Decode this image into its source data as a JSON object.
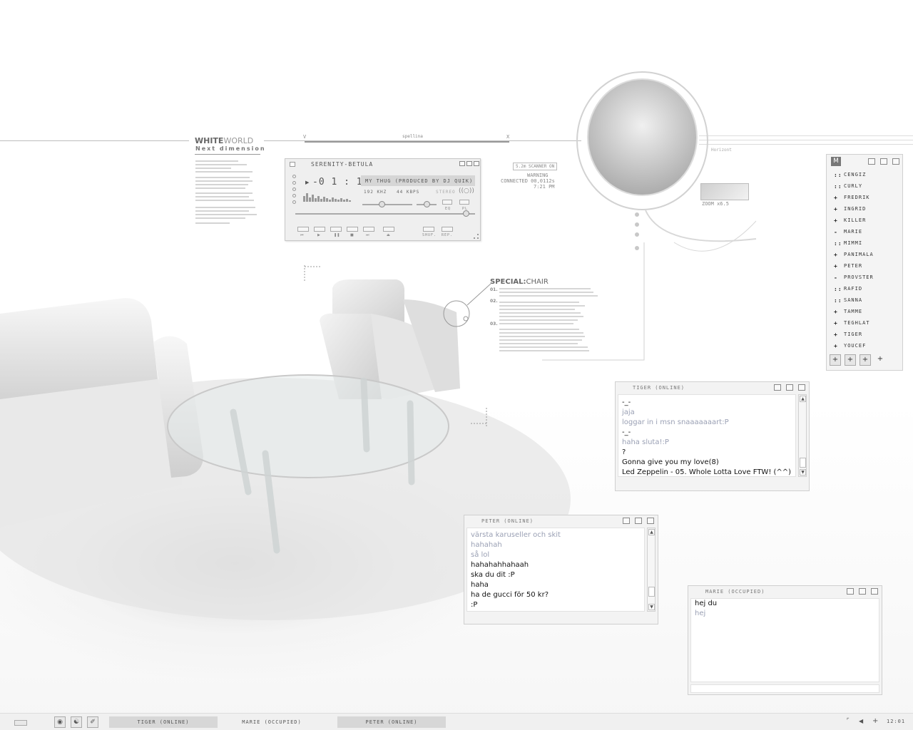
{
  "whiteworld": {
    "title_bold": "WHITE",
    "title_light": "WORLD",
    "subtitle": "Next dimension"
  },
  "hud": {
    "axis_v": "V",
    "axis_x": "X",
    "axis_mid": "spellina",
    "scanner": "5.2m SCANNER ON",
    "warning": "WARNING",
    "connected": "CONNECTED 00,0112s",
    "time": "7:21 PM",
    "zoom": "ZOOM x6.5",
    "horizont": "Horizont"
  },
  "special": {
    "title_bold": "SPECIAL:",
    "title_light": "CHAIR",
    "items": [
      "01.",
      "02.",
      "03."
    ]
  },
  "player": {
    "title": "SERENITY-BETULA",
    "time": "-0 1 : 1 2",
    "track": "MY THUG (PRODUCED BY DJ QUIK)",
    "khz": "192 KHZ",
    "kbps": "44 KBPS",
    "stereo": "STEREO",
    "eq": "EQ",
    "pl": "PL",
    "shuf": "SHUF.",
    "rep": "REP.",
    "volume": 0.38,
    "balance": 0.5,
    "seek": 0.95
  },
  "buddylist": {
    "menu": "M",
    "buddies": [
      {
        "status": "::",
        "name": "CENGIZ"
      },
      {
        "status": "::",
        "name": "CURLY"
      },
      {
        "status": "+",
        "name": "FREDRIK"
      },
      {
        "status": "+",
        "name": "INGRID"
      },
      {
        "status": "+",
        "name": "KILLER"
      },
      {
        "status": "-",
        "name": "MARIE"
      },
      {
        "status": "::",
        "name": "MIMMI"
      },
      {
        "status": "+",
        "name": "PANIMALA"
      },
      {
        "status": "+",
        "name": "PETER"
      },
      {
        "status": "-",
        "name": "PROVSTER"
      },
      {
        "status": "::",
        "name": "RAFID"
      },
      {
        "status": "::",
        "name": "SANNA"
      },
      {
        "status": "+",
        "name": "TAMME"
      },
      {
        "status": "+",
        "name": "TEGHLAT"
      },
      {
        "status": "+",
        "name": "TIGER"
      },
      {
        "status": "+",
        "name": "YOUCEF"
      }
    ],
    "buttons": [
      "+",
      "+",
      "+",
      "+"
    ]
  },
  "chats": {
    "tiger": {
      "title": "TIGER (ONLINE)",
      "messages": [
        {
          "from": "them",
          "text": "-_-"
        },
        {
          "from": "me",
          "text": "jaja"
        },
        {
          "from": "me",
          "text": "loggar in i msn snaaaaaaart:P"
        },
        {
          "from": "them",
          "text": "-_-"
        },
        {
          "from": "me",
          "text": "haha sluta!:P"
        },
        {
          "from": "them",
          "text": "?"
        },
        {
          "from": "them",
          "text": "Gonna give you my love(8)"
        },
        {
          "from": "them",
          "text": "Led Zeppelin - 05. Whole Lotta Love FTW! (^^)"
        }
      ]
    },
    "peter": {
      "title": "PETER (ONLINE)",
      "messages": [
        {
          "from": "me",
          "text": "värsta karuseller och skit"
        },
        {
          "from": "me",
          "text": "hahahah"
        },
        {
          "from": "me",
          "text": "så lol"
        },
        {
          "from": "them",
          "text": "hahahahhahaah"
        },
        {
          "from": "them",
          "text": "ska du dit :P"
        },
        {
          "from": "them",
          "text": "haha"
        },
        {
          "from": "them",
          "text": "ha de gucci för 50 kr?"
        },
        {
          "from": "them",
          "text": ":P"
        }
      ]
    },
    "marie": {
      "title": "MARIE (OCCUPIED)",
      "messages": [
        {
          "from": "them",
          "text": "hej du"
        },
        {
          "from": "me",
          "text": "hej"
        }
      ]
    }
  },
  "taskbar": {
    "tasks": [
      {
        "label": "TIGER (ONLINE)",
        "active": true
      },
      {
        "label": "MARIE (OCCUPIED)",
        "active": false
      },
      {
        "label": "PETER (ONLINE)",
        "active": true
      }
    ],
    "clock": "12:01"
  }
}
